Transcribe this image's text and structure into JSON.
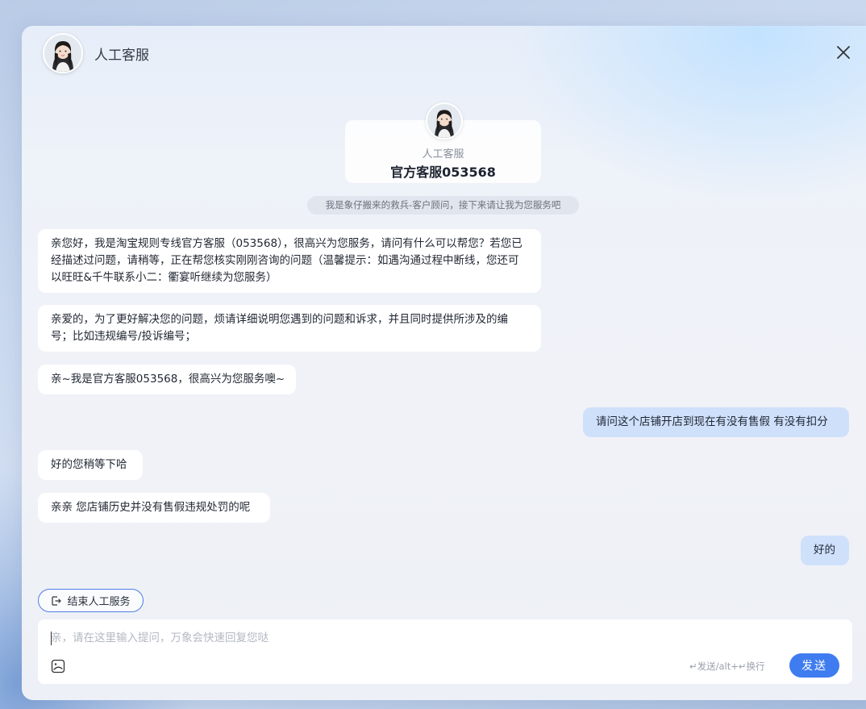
{
  "header": {
    "title": "人工客服"
  },
  "agent_card": {
    "role": "人工客服",
    "name": "官方客服053568"
  },
  "system_notice": "我是象仔搬来的救兵-客户顾问，接下来请让我为您服务吧",
  "messages": [
    {
      "side": "left",
      "text": "亲您好，我是淘宝规则专线官方客服（053568），很高兴为您服务，请问有什么可以帮您？若您已经描述过问题，请稍等，正在帮您核实刚刚咨询的问题（温馨提示：如遇沟通过程中断线，您还可以旺旺&千牛联系小二：衢宴听继续为您服务）"
    },
    {
      "side": "left",
      "text": "亲爱的，为了更好解决您的问题，烦请详细说明您遇到的问题和诉求，并且同时提供所涉及的编号；比如违规编号/投诉编号；"
    },
    {
      "side": "left",
      "text": "亲~我是官方客服053568，很高兴为您服务噢~"
    },
    {
      "side": "right",
      "text": "请问这个店铺开店到现在有没有售假 有没有扣分"
    },
    {
      "side": "left",
      "text": "好的您稍等下哈"
    },
    {
      "side": "left",
      "text": "亲亲 您店铺历史并没有售假违规处罚的呢"
    },
    {
      "side": "right",
      "text": "好的"
    }
  ],
  "end_service_label": "结束人工服务",
  "composer": {
    "placeholder": "亲，请在这里输入提问，万象会快速回复您哒",
    "value": "",
    "hint": "↵发送/alt+↵换行",
    "send_label": "发送"
  },
  "colors": {
    "accent": "#3f7cf0",
    "user_bubble": "#cfe0fb",
    "agent_bubble": "#ffffff"
  },
  "icons": [
    "close-icon",
    "logout-icon",
    "image-emoji-icon",
    "avatar-portrait"
  ]
}
